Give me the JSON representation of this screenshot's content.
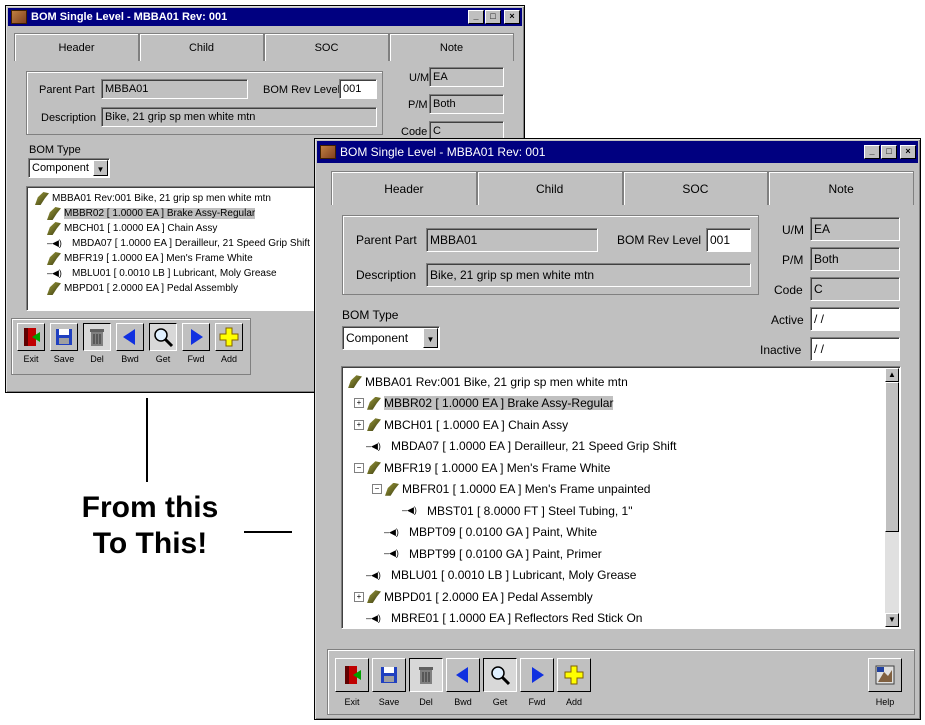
{
  "small_window": {
    "title": "BOM Single Level - MBBA01  Rev: 001",
    "tabs": [
      "Header",
      "Child",
      "SOC",
      "Note"
    ],
    "parent_part_label": "Parent Part",
    "parent_part_value": "MBBA01",
    "bom_rev_label": "BOM Rev Level",
    "bom_rev_value": "001",
    "description_label": "Description",
    "description_value": "Bike, 21 grip sp men white mtn",
    "um_label": "U/M",
    "um_value": "EA",
    "pm_label": "P/M",
    "pm_value": "Both",
    "code_label": "Code",
    "code_value": "C",
    "bom_type_label": "BOM Type",
    "bom_type_value": "Component",
    "tree": [
      {
        "text": "MBBA01 Rev:001 Bike, 21 grip sp men white mtn",
        "type": "root"
      },
      {
        "text": "MBBR02 [ 1.0000 EA ] Brake Assy-Regular",
        "type": "asm",
        "selected": true
      },
      {
        "text": "MBCH01 [ 1.0000 EA ] Chain Assy",
        "type": "asm"
      },
      {
        "text": "MBDA07 [ 1.0000 EA ] Derailleur, 21 Speed Grip Shift",
        "type": "part"
      },
      {
        "text": "MBFR19 [ 1.0000 EA ] Men's Frame White",
        "type": "asm"
      },
      {
        "text": "MBLU01 [ 0.0010 LB ] Lubricant, Moly Grease",
        "type": "part"
      },
      {
        "text": "MBPD01 [ 2.0000 EA ] Pedal Assembly",
        "type": "asm"
      }
    ],
    "toolbar": [
      "Exit",
      "Save",
      "Del",
      "Bwd",
      "Get",
      "Fwd",
      "Add"
    ]
  },
  "large_window": {
    "title": "BOM Single Level - MBBA01  Rev: 001",
    "tabs": [
      "Header",
      "Child",
      "SOC",
      "Note"
    ],
    "parent_part_label": "Parent Part",
    "parent_part_value": "MBBA01",
    "bom_rev_label": "BOM Rev Level",
    "bom_rev_value": "001",
    "description_label": "Description",
    "description_value": "Bike, 21 grip sp men white mtn",
    "um_label": "U/M",
    "um_value": "EA",
    "pm_label": "P/M",
    "pm_value": "Both",
    "code_label": "Code",
    "code_value": "C",
    "active_label": "Active",
    "active_value": "/ /",
    "inactive_label": "Inactive",
    "inactive_value": "/ /",
    "bom_type_label": "BOM Type",
    "bom_type_value": "Component",
    "tree": [
      {
        "text": "MBBA01 Rev:001 Bike, 21 grip sp men white mtn",
        "type": "root",
        "level": 0
      },
      {
        "text": "MBBR02 [ 1.0000 EA ] Brake Assy-Regular",
        "type": "asm",
        "level": 1,
        "exp": "+",
        "selected": true
      },
      {
        "text": "MBCH01 [ 1.0000 EA ] Chain Assy",
        "type": "asm",
        "level": 1,
        "exp": "+"
      },
      {
        "text": "MBDA07 [ 1.0000 EA ] Derailleur, 21 Speed Grip Shift",
        "type": "part",
        "level": 1
      },
      {
        "text": "MBFR19 [ 1.0000 EA ] Men's Frame White",
        "type": "asm",
        "level": 1,
        "exp": "-"
      },
      {
        "text": "MBFR01 [ 1.0000 EA ] Men's Frame unpainted",
        "type": "asm",
        "level": 2,
        "exp": "-"
      },
      {
        "text": "MBST01 [ 8.0000 FT ] Steel Tubing, 1\"",
        "type": "part",
        "level": 3
      },
      {
        "text": "MBPT09 [ 0.0100 GA ] Paint, White",
        "type": "part",
        "level": 2
      },
      {
        "text": "MBPT99 [ 0.0100 GA ] Paint, Primer",
        "type": "part",
        "level": 2
      },
      {
        "text": "MBLU01 [ 0.0010 LB ] Lubricant, Moly Grease",
        "type": "part",
        "level": 1
      },
      {
        "text": "MBPD01 [ 2.0000 EA ] Pedal Assembly",
        "type": "asm",
        "level": 1,
        "exp": "+"
      },
      {
        "text": "MBRE01 [ 1.0000 EA ] Reflectors  Red Stick On",
        "type": "part",
        "level": 1
      }
    ],
    "toolbar": [
      "Exit",
      "Save",
      "Del",
      "Bwd",
      "Get",
      "Fwd",
      "Add"
    ],
    "help_label": "Help"
  },
  "callout": {
    "line1": "From this",
    "line2": "To This!"
  }
}
